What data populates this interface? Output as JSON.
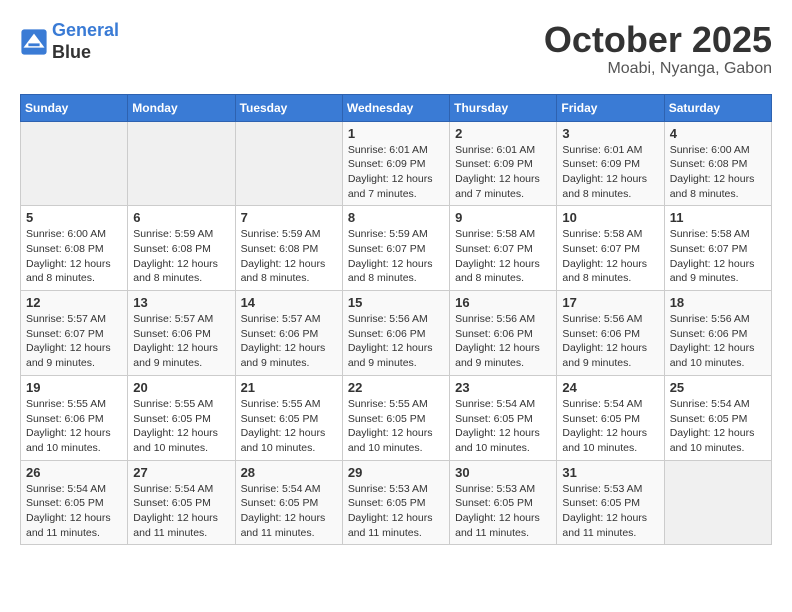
{
  "header": {
    "logo_line1": "General",
    "logo_line2": "Blue",
    "month": "October 2025",
    "location": "Moabi, Nyanga, Gabon"
  },
  "weekdays": [
    "Sunday",
    "Monday",
    "Tuesday",
    "Wednesday",
    "Thursday",
    "Friday",
    "Saturday"
  ],
  "weeks": [
    [
      {
        "day": "",
        "sunrise": "",
        "sunset": "",
        "daylight": ""
      },
      {
        "day": "",
        "sunrise": "",
        "sunset": "",
        "daylight": ""
      },
      {
        "day": "",
        "sunrise": "",
        "sunset": "",
        "daylight": ""
      },
      {
        "day": "1",
        "sunrise": "Sunrise: 6:01 AM",
        "sunset": "Sunset: 6:09 PM",
        "daylight": "Daylight: 12 hours and 7 minutes."
      },
      {
        "day": "2",
        "sunrise": "Sunrise: 6:01 AM",
        "sunset": "Sunset: 6:09 PM",
        "daylight": "Daylight: 12 hours and 7 minutes."
      },
      {
        "day": "3",
        "sunrise": "Sunrise: 6:01 AM",
        "sunset": "Sunset: 6:09 PM",
        "daylight": "Daylight: 12 hours and 8 minutes."
      },
      {
        "day": "4",
        "sunrise": "Sunrise: 6:00 AM",
        "sunset": "Sunset: 6:08 PM",
        "daylight": "Daylight: 12 hours and 8 minutes."
      }
    ],
    [
      {
        "day": "5",
        "sunrise": "Sunrise: 6:00 AM",
        "sunset": "Sunset: 6:08 PM",
        "daylight": "Daylight: 12 hours and 8 minutes."
      },
      {
        "day": "6",
        "sunrise": "Sunrise: 5:59 AM",
        "sunset": "Sunset: 6:08 PM",
        "daylight": "Daylight: 12 hours and 8 minutes."
      },
      {
        "day": "7",
        "sunrise": "Sunrise: 5:59 AM",
        "sunset": "Sunset: 6:08 PM",
        "daylight": "Daylight: 12 hours and 8 minutes."
      },
      {
        "day": "8",
        "sunrise": "Sunrise: 5:59 AM",
        "sunset": "Sunset: 6:07 PM",
        "daylight": "Daylight: 12 hours and 8 minutes."
      },
      {
        "day": "9",
        "sunrise": "Sunrise: 5:58 AM",
        "sunset": "Sunset: 6:07 PM",
        "daylight": "Daylight: 12 hours and 8 minutes."
      },
      {
        "day": "10",
        "sunrise": "Sunrise: 5:58 AM",
        "sunset": "Sunset: 6:07 PM",
        "daylight": "Daylight: 12 hours and 8 minutes."
      },
      {
        "day": "11",
        "sunrise": "Sunrise: 5:58 AM",
        "sunset": "Sunset: 6:07 PM",
        "daylight": "Daylight: 12 hours and 9 minutes."
      }
    ],
    [
      {
        "day": "12",
        "sunrise": "Sunrise: 5:57 AM",
        "sunset": "Sunset: 6:07 PM",
        "daylight": "Daylight: 12 hours and 9 minutes."
      },
      {
        "day": "13",
        "sunrise": "Sunrise: 5:57 AM",
        "sunset": "Sunset: 6:06 PM",
        "daylight": "Daylight: 12 hours and 9 minutes."
      },
      {
        "day": "14",
        "sunrise": "Sunrise: 5:57 AM",
        "sunset": "Sunset: 6:06 PM",
        "daylight": "Daylight: 12 hours and 9 minutes."
      },
      {
        "day": "15",
        "sunrise": "Sunrise: 5:56 AM",
        "sunset": "Sunset: 6:06 PM",
        "daylight": "Daylight: 12 hours and 9 minutes."
      },
      {
        "day": "16",
        "sunrise": "Sunrise: 5:56 AM",
        "sunset": "Sunset: 6:06 PM",
        "daylight": "Daylight: 12 hours and 9 minutes."
      },
      {
        "day": "17",
        "sunrise": "Sunrise: 5:56 AM",
        "sunset": "Sunset: 6:06 PM",
        "daylight": "Daylight: 12 hours and 9 minutes."
      },
      {
        "day": "18",
        "sunrise": "Sunrise: 5:56 AM",
        "sunset": "Sunset: 6:06 PM",
        "daylight": "Daylight: 12 hours and 10 minutes."
      }
    ],
    [
      {
        "day": "19",
        "sunrise": "Sunrise: 5:55 AM",
        "sunset": "Sunset: 6:06 PM",
        "daylight": "Daylight: 12 hours and 10 minutes."
      },
      {
        "day": "20",
        "sunrise": "Sunrise: 5:55 AM",
        "sunset": "Sunset: 6:05 PM",
        "daylight": "Daylight: 12 hours and 10 minutes."
      },
      {
        "day": "21",
        "sunrise": "Sunrise: 5:55 AM",
        "sunset": "Sunset: 6:05 PM",
        "daylight": "Daylight: 12 hours and 10 minutes."
      },
      {
        "day": "22",
        "sunrise": "Sunrise: 5:55 AM",
        "sunset": "Sunset: 6:05 PM",
        "daylight": "Daylight: 12 hours and 10 minutes."
      },
      {
        "day": "23",
        "sunrise": "Sunrise: 5:54 AM",
        "sunset": "Sunset: 6:05 PM",
        "daylight": "Daylight: 12 hours and 10 minutes."
      },
      {
        "day": "24",
        "sunrise": "Sunrise: 5:54 AM",
        "sunset": "Sunset: 6:05 PM",
        "daylight": "Daylight: 12 hours and 10 minutes."
      },
      {
        "day": "25",
        "sunrise": "Sunrise: 5:54 AM",
        "sunset": "Sunset: 6:05 PM",
        "daylight": "Daylight: 12 hours and 10 minutes."
      }
    ],
    [
      {
        "day": "26",
        "sunrise": "Sunrise: 5:54 AM",
        "sunset": "Sunset: 6:05 PM",
        "daylight": "Daylight: 12 hours and 11 minutes."
      },
      {
        "day": "27",
        "sunrise": "Sunrise: 5:54 AM",
        "sunset": "Sunset: 6:05 PM",
        "daylight": "Daylight: 12 hours and 11 minutes."
      },
      {
        "day": "28",
        "sunrise": "Sunrise: 5:54 AM",
        "sunset": "Sunset: 6:05 PM",
        "daylight": "Daylight: 12 hours and 11 minutes."
      },
      {
        "day": "29",
        "sunrise": "Sunrise: 5:53 AM",
        "sunset": "Sunset: 6:05 PM",
        "daylight": "Daylight: 12 hours and 11 minutes."
      },
      {
        "day": "30",
        "sunrise": "Sunrise: 5:53 AM",
        "sunset": "Sunset: 6:05 PM",
        "daylight": "Daylight: 12 hours and 11 minutes."
      },
      {
        "day": "31",
        "sunrise": "Sunrise: 5:53 AM",
        "sunset": "Sunset: 6:05 PM",
        "daylight": "Daylight: 12 hours and 11 minutes."
      },
      {
        "day": "",
        "sunrise": "",
        "sunset": "",
        "daylight": ""
      }
    ]
  ]
}
